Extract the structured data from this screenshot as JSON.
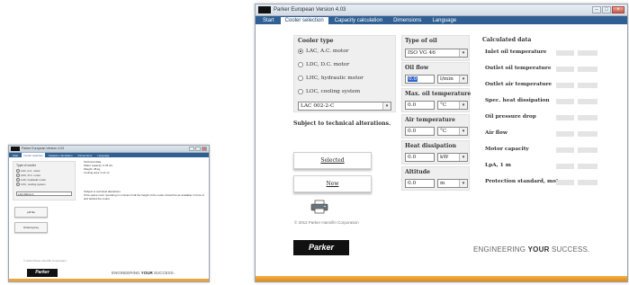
{
  "app": {
    "title": "Parker European Version 4.03",
    "tabs": [
      "Start",
      "Cooler selection",
      "Capacity calculation",
      "Dimensions",
      "Language"
    ],
    "active_tab": "Cooler selection"
  },
  "cooler_type": {
    "title": "Cooler type",
    "options": [
      "LAC, A.C. motor",
      "LDC, D.C. motor",
      "LHC, hydraulic motor",
      "LOC, cooling system"
    ],
    "selected_index": 0,
    "model": "LAC 002-2-C"
  },
  "subject_note": "Subject to technical alterations.",
  "buttons": {
    "selected": "Selected",
    "new": "New"
  },
  "type_of_oil": {
    "title": "Type of oil",
    "value": "ISO VG 46"
  },
  "oil_flow": {
    "title": "Oil flow",
    "value": "0.0",
    "unit": "l/min"
  },
  "max_oil_temp": {
    "title": "Max. oil temperature",
    "value": "0.0",
    "unit": "°C"
  },
  "air_temp": {
    "title": "Air temperature",
    "value": "0.0",
    "unit": "°C"
  },
  "heat_dissipation": {
    "title": "Heat dissipation",
    "value": "0.0",
    "unit": "kW"
  },
  "altitude": {
    "title": "Altitude",
    "value": "0.0",
    "unit": "m"
  },
  "calculated": {
    "title": "Calculated data",
    "rows": [
      "Inlet oil temperature",
      "Outlet oil temperature",
      "Outlet air temperature",
      "Spec. heat dissipation",
      "Oil pressure drop",
      "Air flow",
      "Motor capacity",
      "LpA, 1 m",
      "Protection standard, motor"
    ]
  },
  "footer": {
    "copyright": "© 2012 Parker Hannifin Corporation",
    "logo": "Parker",
    "slogan_pre": "ENGINEERING ",
    "slogan_bold": "YOUR",
    "slogan_post": " SUCCESS."
  },
  "thumb": {
    "title": "Parker European Version 4.03",
    "tabs": [
      "Start",
      "Cooler selection",
      "Capacity calculation",
      "Dimensions",
      "Language"
    ],
    "cooler_type": "Type of cooler",
    "options": [
      "LAC, A.C. motor",
      "LDC, D.C. motor",
      "LHC, hydraulic motor",
      "LOC, cooling system"
    ],
    "model": "LAC 002-2-C",
    "data_title": "Technical data",
    "data_lines": [
      "Water capacity: 0.35 dm",
      "Weight: 38 kg",
      "Cooling area: 0.11 m²"
    ],
    "note_title": "Subject to technical alterations.",
    "note_body": "If the space room operating in minimum half the height of the cooler should be as available in front of and behind the cooler.",
    "btn1": "pdf file",
    "btn2": "Ordering key",
    "copyright": "© 2012 Parker Hannifin Corporation",
    "logo": "Parker",
    "slogan_pre": "ENGINEERING ",
    "slogan_bold": "YOUR",
    "slogan_post": " SUCCESS."
  },
  "colors": {
    "menubar": "#2f5f93",
    "accent_orange": "#e48b16"
  }
}
